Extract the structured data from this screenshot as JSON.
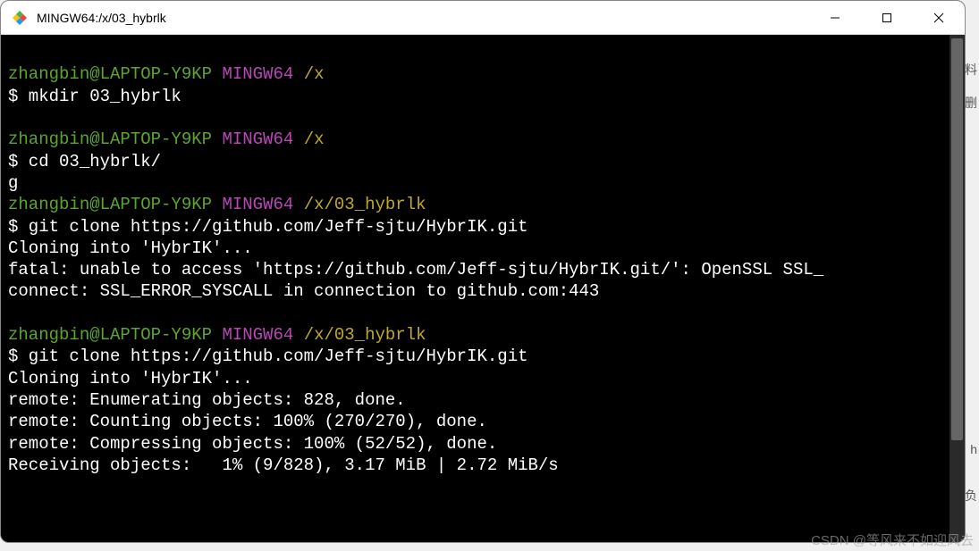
{
  "window": {
    "title": "MINGW64:/x/03_hybrlk"
  },
  "terminal": {
    "prompts": [
      {
        "user": "zhangbin@LAPTOP-Y9KP",
        "env": "MINGW64",
        "path": "/x"
      },
      {
        "user": "zhangbin@LAPTOP-Y9KP",
        "env": "MINGW64",
        "path": "/x"
      },
      {
        "user": "zhangbin@LAPTOP-Y9KP",
        "env": "MINGW64",
        "path": "/x/03_hybrlk"
      },
      {
        "user": "zhangbin@LAPTOP-Y9KP",
        "env": "MINGW64",
        "path": "/x/03_hybrlk"
      }
    ],
    "commands": {
      "mkdir": "$ mkdir 03_hybrlk",
      "cd": "$ cd 03_hybrlk/",
      "stray_g": "g",
      "gitclone1": "$ git clone https://github.com/Jeff-sjtu/HybrIK.git",
      "gitclone2": "$ git clone https://github.com/Jeff-sjtu/HybrIK.git"
    },
    "output": {
      "cloning1": "Cloning into 'HybrIK'...",
      "fatal1": "fatal: unable to access 'https://github.com/Jeff-sjtu/HybrIK.git/': OpenSSL SSL_",
      "fatal2": "connect: SSL_ERROR_SYSCALL in connection to github.com:443",
      "cloning2": "Cloning into 'HybrIK'...",
      "enum": "remote: Enumerating objects: 828, done.",
      "count": "remote: Counting objects: 100% (270/270), done.",
      "compress": "remote: Compressing objects: 100% (52/52), done.",
      "receiving": "Receiving objects:   1% (9/828), 3.17 MiB | 2.72 MiB/s"
    }
  },
  "side_hints": {
    "c1": "料",
    "c2": "删",
    "c3": "h",
    "c4": "负"
  },
  "watermark": "CSDN @等风来不如迎风去"
}
